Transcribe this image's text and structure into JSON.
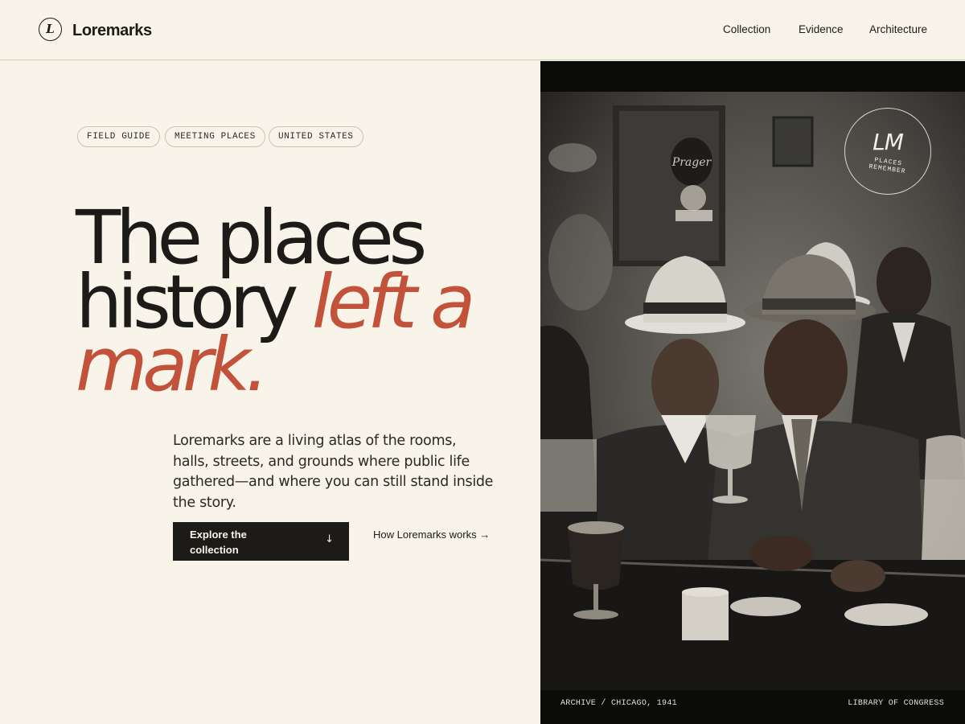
{
  "header": {
    "logo_letter": "L",
    "brand": "Loremarks",
    "nav": [
      {
        "label": "Collection"
      },
      {
        "label": "Evidence"
      },
      {
        "label": "Architecture"
      }
    ]
  },
  "tags": [
    "FIELD GUIDE",
    "MEETING PLACES",
    "UNITED STATES"
  ],
  "hero": {
    "line1": "The places",
    "line2_plain": "history ",
    "line2_accent": "left a",
    "line3_accent": "mark.",
    "lede": "Loremarks are a living atlas of the rooms, halls, streets, and grounds where public life gathered—and where you can still stand inside the story.",
    "primary_cta": "Explore the collection",
    "primary_cta_icon": "↓",
    "secondary_cta": "How Loremarks works →"
  },
  "photo": {
    "badge_mark": "LM",
    "badge_line1": "PLACES",
    "badge_line2": "REMEMBER",
    "caption_left": "ARCHIVE / CHICAGO, 1941",
    "caption_right": "LIBRARY OF CONGRESS",
    "sign_text": "Prager"
  },
  "colors": {
    "background": "#f8f4ea",
    "ink": "#1c1b18",
    "accent": "#c2533a"
  }
}
